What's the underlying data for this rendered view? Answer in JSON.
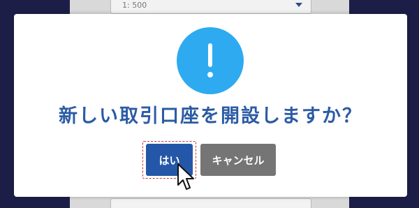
{
  "background": {
    "scale_select_value": "1: 500"
  },
  "dialog": {
    "message": "新しい取引口座を開設しますか？",
    "yes_label": "はい",
    "cancel_label": "キャンセル",
    "icon": "exclamation-icon"
  },
  "colors": {
    "overlay": "#1d1e48",
    "icon_circle": "#2eaaf0",
    "message_text": "#2c5ba5",
    "yes_button": "#2457a8",
    "cancel_button": "#757575"
  }
}
